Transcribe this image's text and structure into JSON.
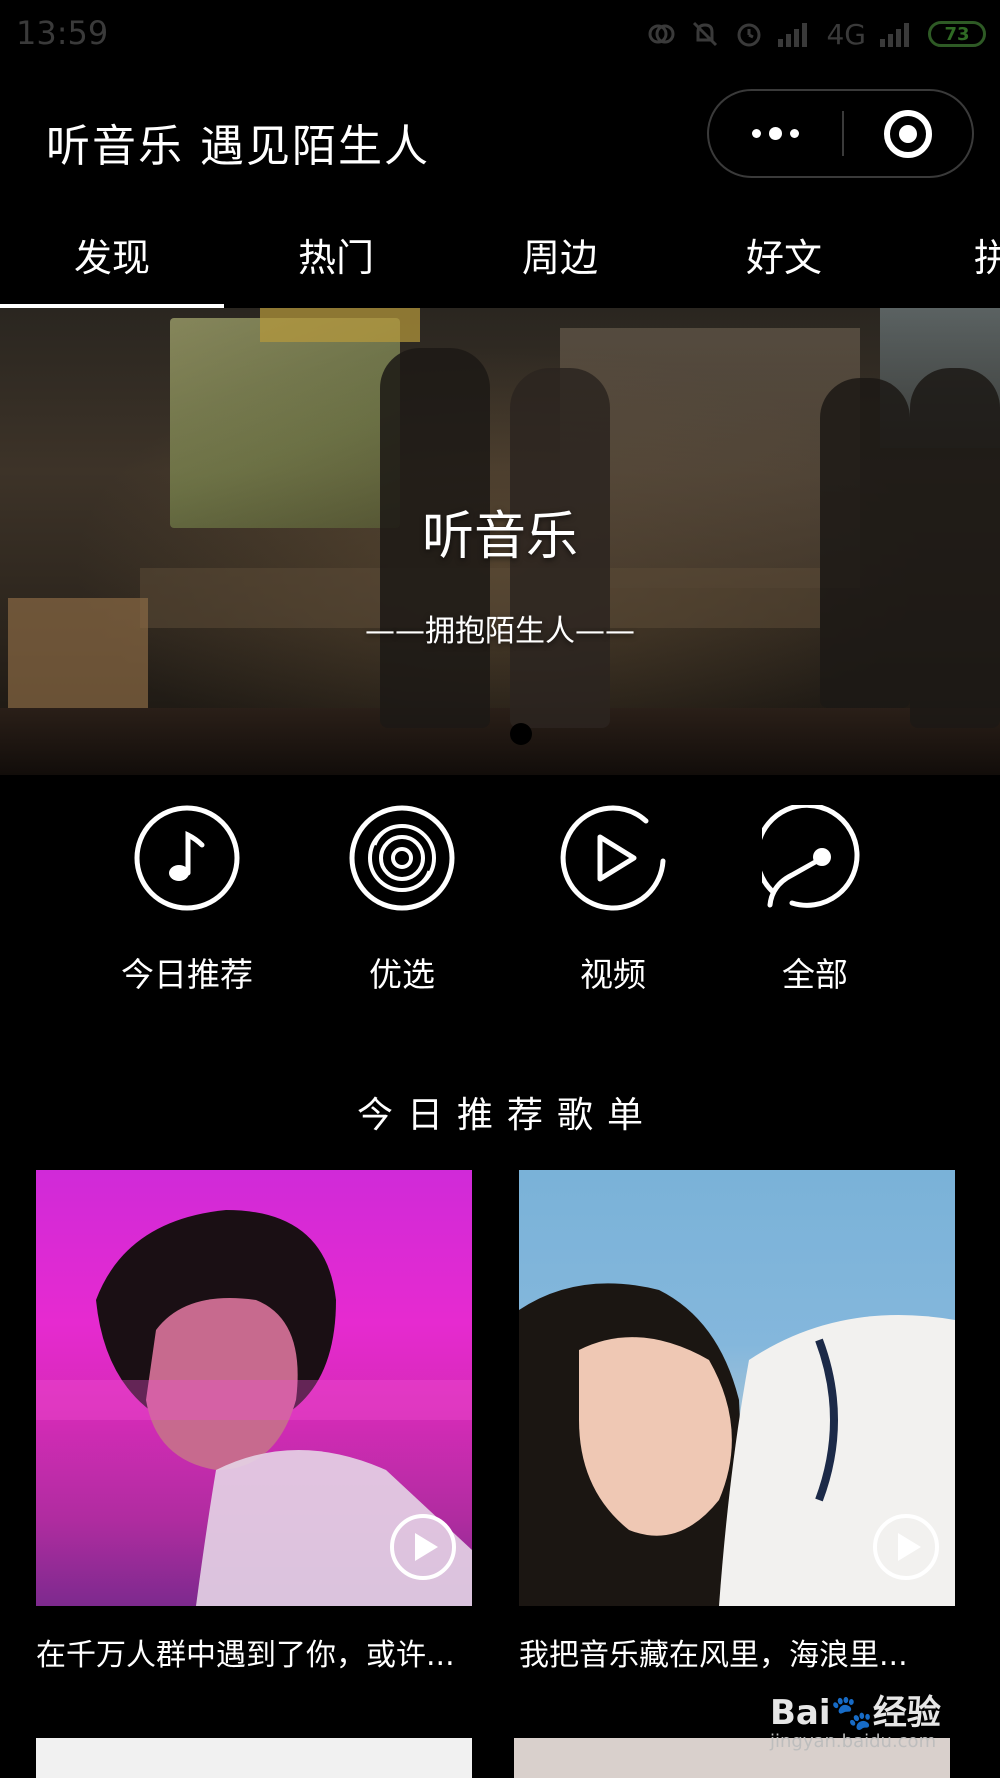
{
  "status_bar": {
    "time": "13:59",
    "network": "4G",
    "battery": "73"
  },
  "header": {
    "title": "听音乐 遇见陌生人"
  },
  "tabs": [
    {
      "label": "发现"
    },
    {
      "label": "热门"
    },
    {
      "label": "周边"
    },
    {
      "label": "好文"
    },
    {
      "label": "拼"
    }
  ],
  "banner": {
    "title": "听音乐",
    "subtitle": "——拥抱陌生人——"
  },
  "entries": [
    {
      "label": "今日推荐",
      "icon": "music-note-icon"
    },
    {
      "label": "优选",
      "icon": "vinyl-disc-icon"
    },
    {
      "label": "视频",
      "icon": "play-circle-icon"
    },
    {
      "label": "全部",
      "icon": "compass-icon"
    }
  ],
  "section": {
    "title": "今日推荐歌单"
  },
  "playlists": [
    {
      "caption": "在千万人群中遇到了你，或许..."
    },
    {
      "caption": "我把音乐藏在风里，海浪里..."
    }
  ],
  "watermark": {
    "logo": "Bai🐾经验",
    "url": "jingyan.baidu.com"
  },
  "colors": {
    "background": "#000000",
    "text": "#ffffff",
    "status": "#3a3a3a",
    "battery": "#2f6b24"
  }
}
